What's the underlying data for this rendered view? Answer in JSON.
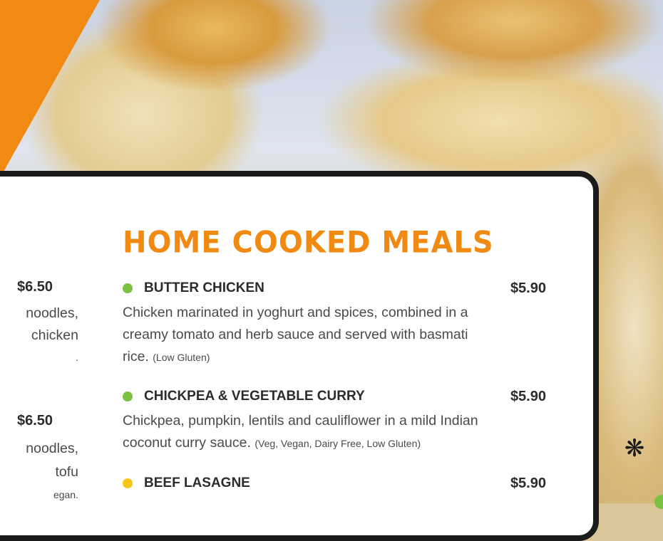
{
  "section": {
    "title": "HOME COOKED MEALS"
  },
  "colors": {
    "accent": "#f08a12",
    "card_border": "#1b1b1b",
    "dot_green": "#7cc242",
    "dot_yellow": "#f5c518"
  },
  "left_column": {
    "items": [
      {
        "price": "$6.50",
        "lines": [
          "noodles,",
          "chicken",
          "."
        ]
      },
      {
        "price": "$6.50",
        "lines": [
          "noodles,",
          "tofu",
          "egan."
        ]
      }
    ]
  },
  "items": [
    {
      "name": "BUTTER CHICKEN",
      "price": "$5.90",
      "dot": "green",
      "desc_lines": [
        "Chicken marinated in yoghurt and spices, combined in a",
        "creamy tomato and herb sauce and served with basmati",
        "rice."
      ],
      "tag": "(Low Gluten)"
    },
    {
      "name": "CHICKPEA & VEGETABLE CURRY",
      "price": "$5.90",
      "dot": "green",
      "desc_lines": [
        "Chickpea, pumpkin, lentils and cauliflower in a mild Indian",
        "coconut curry sauce."
      ],
      "tag": "(Veg, Vegan, Dairy Free, Low Gluten)"
    },
    {
      "name": "BEEF LASAGNE",
      "price": "$5.90",
      "dot": "yellow"
    }
  ],
  "icons": {
    "decor": "flower-icon"
  }
}
